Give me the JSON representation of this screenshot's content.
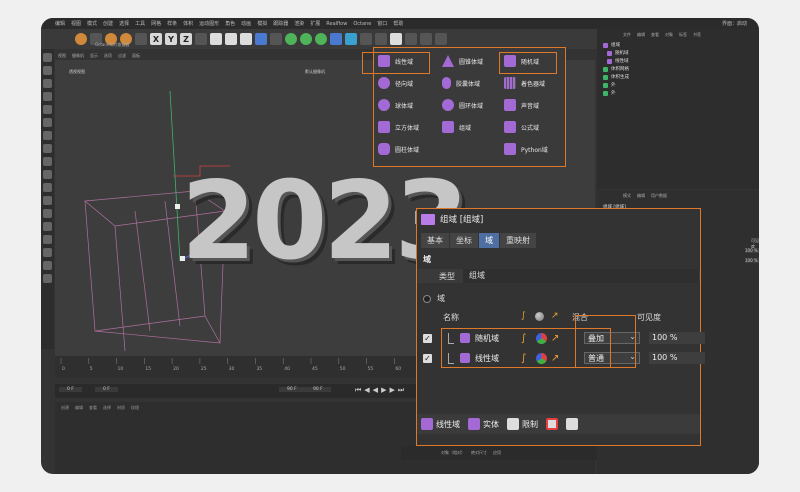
{
  "menubar": [
    "编辑",
    "视图",
    "模式",
    "创建",
    "选择",
    "工具",
    "网格",
    "样条",
    "体积",
    "运动图形",
    "角色",
    "动画",
    "模拟",
    "跟踪器",
    "渲染",
    "扩展",
    "Realflow",
    "Octane",
    "窗口",
    "帮助"
  ],
  "layout_label": "界面：启动",
  "toolbar": {
    "x": "X",
    "y": "Y",
    "z": "Z"
  },
  "viewport": {
    "menu": [
      "视图",
      "摄像机",
      "显示",
      "选项",
      "过滤",
      "面板"
    ],
    "label": "透视视图",
    "camera": "默认摄像机",
    "title_text": "2023",
    "octane": "Octane实时查看器"
  },
  "timeline": {
    "start": "0 F",
    "cur": "0 F",
    "end": "90 F",
    "end2": "90 F",
    "ticks": [
      "0",
      "5",
      "10",
      "15",
      "20",
      "25",
      "30",
      "35",
      "40",
      "45",
      "50",
      "55",
      "60",
      "65",
      "70",
      "75",
      "80",
      "85",
      "90"
    ]
  },
  "material_menu": [
    "创建",
    "编辑",
    "查看",
    "选择",
    "材质",
    "纹理"
  ],
  "bottom_bar": [
    "对象（相对）",
    "绝对尺寸",
    "应用"
  ],
  "object_panel": {
    "menu": [
      "文件",
      "编辑",
      "查看",
      "对象",
      "标签",
      "书签"
    ],
    "items": [
      "组域",
      "随机域",
      "线性域",
      "体积网格",
      "体积生成",
      "外",
      "外"
    ]
  },
  "attr_small": {
    "menu": [
      "模式",
      "编辑",
      "用户数据"
    ],
    "title": "组域 [组域]",
    "tabs": [
      "基本",
      "坐标",
      "域",
      "重映射"
    ],
    "col": "可见度",
    "vals": [
      "100 %",
      "100 %"
    ]
  },
  "field_menu": {
    "col1": [
      "线性域",
      "径向域",
      "球体域",
      "立方体域",
      "圆柱体域"
    ],
    "col2": [
      "圆锥体域",
      "胶囊体域",
      "圆环体域",
      "组域"
    ],
    "col3": [
      "随机域",
      "着色器域",
      "声音域",
      "公式域",
      "Python域"
    ]
  },
  "attr": {
    "title": "组域 [组域]",
    "tabs": [
      "基本",
      "坐标",
      "域",
      "重映射"
    ],
    "active_tab": "域",
    "section": "域",
    "type_label": "类型",
    "type_value": "组域",
    "field_label": "域",
    "col_name": "名称",
    "col_mix": "混合",
    "col_vis": "可见度",
    "rows": [
      {
        "name": "随机域",
        "mix": "叠加",
        "vis": "100 %"
      },
      {
        "name": "线性域",
        "mix": "普通",
        "vis": "100 %"
      }
    ],
    "footer": {
      "linear": "线性域",
      "solid": "实体",
      "limit": "限制"
    }
  },
  "colors": {
    "accent": "#e0782a",
    "field_purple": "#a36ad6",
    "active_tab": "#4f6fa3"
  }
}
